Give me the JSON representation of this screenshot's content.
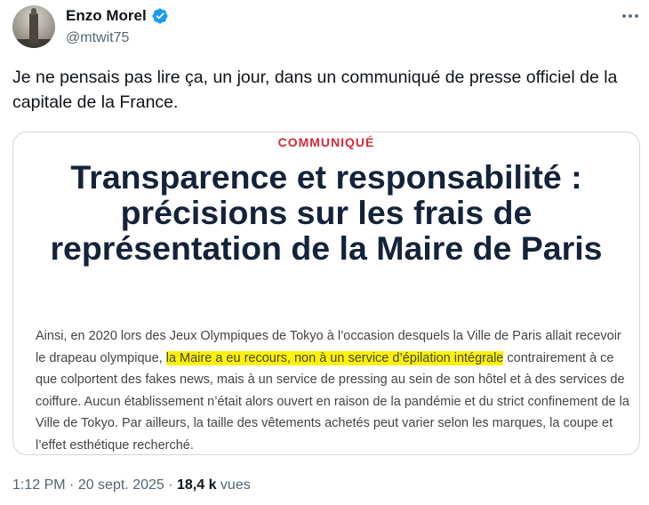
{
  "author": {
    "name": "Enzo Morel",
    "handle": "@mtwit75",
    "verified": true,
    "verified_color": "#1d9bf0"
  },
  "more_icon": "more-horizontal-icon",
  "tweet": {
    "text": "Je ne pensais pas lire ça, un jour, dans un communiqué de presse officiel de la capitale de la France."
  },
  "card": {
    "tag": "COMMUNIQUÉ",
    "tag_color": "#d42b3a",
    "headline": "Transparence et responsabilité : précisions sur les frais de représentation de la Maire de Paris",
    "headline_color": "#14233b",
    "body_before": "Ainsi, en 2020 lors des Jeux Olympiques de Tokyo à l’occasion desquels la Ville de Paris allait recevoir le drapeau olympique, ",
    "body_highlight": "la Maire a eu recours, non à un service d’épilation intégrale",
    "body_after": " contrairement à ce que colportent des fakes news, mais à un service de pressing au sein de son hôtel et à des services de coiffure. Aucun établissement n’était alors ouvert en raison de la pandémie et du strict confinement de la Ville de Tokyo. Par ailleurs, la taille des vêtements achetés peut varier selon les marques, la coupe et l’effet esthétique recherché.",
    "highlight_color": "#fff200"
  },
  "meta": {
    "time": "1:12 PM",
    "sep1": " · ",
    "date": "20 sept. 2025",
    "sep2": " · ",
    "views_count": "18,4 k",
    "views_label": " vues"
  }
}
